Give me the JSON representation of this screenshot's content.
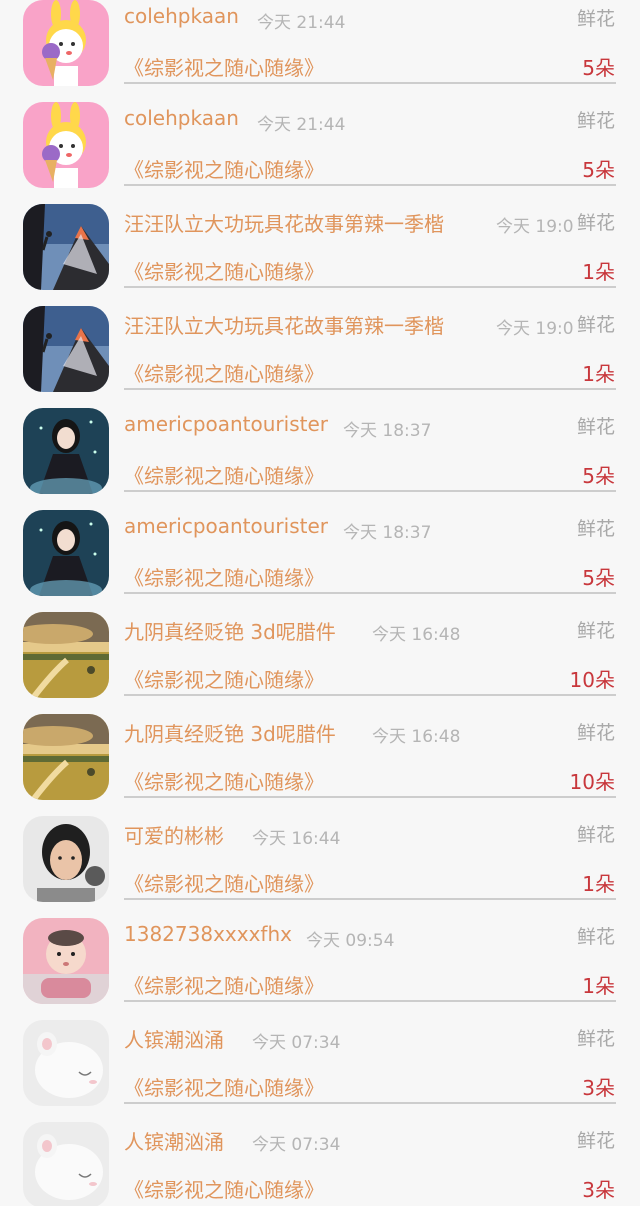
{
  "gift_records": [
    {
      "user": "colehpkaan",
      "time": "今天 21:44",
      "gift_type": "鲜花",
      "book": "《综影视之随心随缘》",
      "count": "5朵",
      "avatar": "bunny-icecream-avatar"
    },
    {
      "user": "colehpkaan",
      "time": "今天 21:44",
      "gift_type": "鲜花",
      "book": "《综影视之随心随缘》",
      "count": "5朵",
      "avatar": "bunny-icecream-avatar"
    },
    {
      "user": "汪汪队立大功玩具花故事第辣一季楷",
      "time": "今天 19:0",
      "gift_type": "鲜花",
      "book": "《综影视之随心随缘》",
      "count": "1朵",
      "avatar": "mountain-climber-avatar"
    },
    {
      "user": "汪汪队立大功玩具花故事第辣一季楷",
      "time": "今天 19:0",
      "gift_type": "鲜花",
      "book": "《综影视之随心随缘》",
      "count": "1朵",
      "avatar": "mountain-climber-avatar"
    },
    {
      "user": "americpoantourister",
      "time": "今天 18:37",
      "gift_type": "鲜花",
      "book": "《综影视之随心随缘》",
      "count": "5朵",
      "avatar": "anime-girl-avatar"
    },
    {
      "user": "americpoantourister",
      "time": "今天 18:37",
      "gift_type": "鲜花",
      "book": "《综影视之随心随缘》",
      "count": "5朵",
      "avatar": "anime-girl-avatar"
    },
    {
      "user": "九阴真经贬铯 3d呢腊件",
      "time": "今天 16:48",
      "gift_type": "鲜花",
      "book": "《综影视之随心随缘》",
      "count": "10朵",
      "avatar": "savanna-landscape-avatar"
    },
    {
      "user": "九阴真经贬铯 3d呢腊件",
      "time": "今天 16:48",
      "gift_type": "鲜花",
      "book": "《综影视之随心随缘》",
      "count": "10朵",
      "avatar": "savanna-landscape-avatar"
    },
    {
      "user": "可爱的彬彬",
      "time": "今天 16:44",
      "gift_type": "鲜花",
      "book": "《综影视之随心随缘》",
      "count": "1朵",
      "avatar": "woman-photo-avatar"
    },
    {
      "user": "1382738xxxxfhx",
      "time": "今天 09:54",
      "gift_type": "鲜花",
      "book": "《综影视之随心随缘》",
      "count": "1朵",
      "avatar": "baby-photo-avatar"
    },
    {
      "user": "人镔潮汹涌",
      "time": "今天 07:34",
      "gift_type": "鲜花",
      "book": "《综影视之随心随缘》",
      "count": "3朵",
      "avatar": "white-figurine-avatar"
    },
    {
      "user": "人镔潮汹涌",
      "time": "今天 07:34",
      "gift_type": "鲜花",
      "book": "《综影视之随心随缘》",
      "count": "3朵",
      "avatar": "white-figurine-avatar"
    }
  ]
}
